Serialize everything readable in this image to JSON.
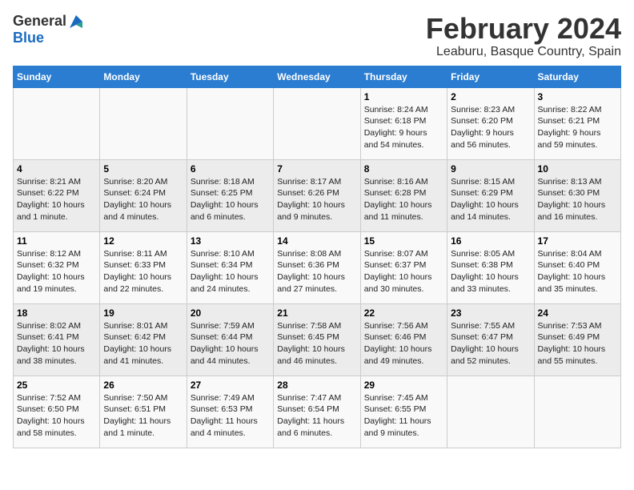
{
  "header": {
    "logo_general": "General",
    "logo_blue": "Blue",
    "month_title": "February 2024",
    "location": "Leaburu, Basque Country, Spain"
  },
  "weekdays": [
    "Sunday",
    "Monday",
    "Tuesday",
    "Wednesday",
    "Thursday",
    "Friday",
    "Saturday"
  ],
  "weeks": [
    [
      {
        "day": "",
        "info": ""
      },
      {
        "day": "",
        "info": ""
      },
      {
        "day": "",
        "info": ""
      },
      {
        "day": "",
        "info": ""
      },
      {
        "day": "1",
        "info": "Sunrise: 8:24 AM\nSunset: 6:18 PM\nDaylight: 9 hours\nand 54 minutes."
      },
      {
        "day": "2",
        "info": "Sunrise: 8:23 AM\nSunset: 6:20 PM\nDaylight: 9 hours\nand 56 minutes."
      },
      {
        "day": "3",
        "info": "Sunrise: 8:22 AM\nSunset: 6:21 PM\nDaylight: 9 hours\nand 59 minutes."
      }
    ],
    [
      {
        "day": "4",
        "info": "Sunrise: 8:21 AM\nSunset: 6:22 PM\nDaylight: 10 hours\nand 1 minute."
      },
      {
        "day": "5",
        "info": "Sunrise: 8:20 AM\nSunset: 6:24 PM\nDaylight: 10 hours\nand 4 minutes."
      },
      {
        "day": "6",
        "info": "Sunrise: 8:18 AM\nSunset: 6:25 PM\nDaylight: 10 hours\nand 6 minutes."
      },
      {
        "day": "7",
        "info": "Sunrise: 8:17 AM\nSunset: 6:26 PM\nDaylight: 10 hours\nand 9 minutes."
      },
      {
        "day": "8",
        "info": "Sunrise: 8:16 AM\nSunset: 6:28 PM\nDaylight: 10 hours\nand 11 minutes."
      },
      {
        "day": "9",
        "info": "Sunrise: 8:15 AM\nSunset: 6:29 PM\nDaylight: 10 hours\nand 14 minutes."
      },
      {
        "day": "10",
        "info": "Sunrise: 8:13 AM\nSunset: 6:30 PM\nDaylight: 10 hours\nand 16 minutes."
      }
    ],
    [
      {
        "day": "11",
        "info": "Sunrise: 8:12 AM\nSunset: 6:32 PM\nDaylight: 10 hours\nand 19 minutes."
      },
      {
        "day": "12",
        "info": "Sunrise: 8:11 AM\nSunset: 6:33 PM\nDaylight: 10 hours\nand 22 minutes."
      },
      {
        "day": "13",
        "info": "Sunrise: 8:10 AM\nSunset: 6:34 PM\nDaylight: 10 hours\nand 24 minutes."
      },
      {
        "day": "14",
        "info": "Sunrise: 8:08 AM\nSunset: 6:36 PM\nDaylight: 10 hours\nand 27 minutes."
      },
      {
        "day": "15",
        "info": "Sunrise: 8:07 AM\nSunset: 6:37 PM\nDaylight: 10 hours\nand 30 minutes."
      },
      {
        "day": "16",
        "info": "Sunrise: 8:05 AM\nSunset: 6:38 PM\nDaylight: 10 hours\nand 33 minutes."
      },
      {
        "day": "17",
        "info": "Sunrise: 8:04 AM\nSunset: 6:40 PM\nDaylight: 10 hours\nand 35 minutes."
      }
    ],
    [
      {
        "day": "18",
        "info": "Sunrise: 8:02 AM\nSunset: 6:41 PM\nDaylight: 10 hours\nand 38 minutes."
      },
      {
        "day": "19",
        "info": "Sunrise: 8:01 AM\nSunset: 6:42 PM\nDaylight: 10 hours\nand 41 minutes."
      },
      {
        "day": "20",
        "info": "Sunrise: 7:59 AM\nSunset: 6:44 PM\nDaylight: 10 hours\nand 44 minutes."
      },
      {
        "day": "21",
        "info": "Sunrise: 7:58 AM\nSunset: 6:45 PM\nDaylight: 10 hours\nand 46 minutes."
      },
      {
        "day": "22",
        "info": "Sunrise: 7:56 AM\nSunset: 6:46 PM\nDaylight: 10 hours\nand 49 minutes."
      },
      {
        "day": "23",
        "info": "Sunrise: 7:55 AM\nSunset: 6:47 PM\nDaylight: 10 hours\nand 52 minutes."
      },
      {
        "day": "24",
        "info": "Sunrise: 7:53 AM\nSunset: 6:49 PM\nDaylight: 10 hours\nand 55 minutes."
      }
    ],
    [
      {
        "day": "25",
        "info": "Sunrise: 7:52 AM\nSunset: 6:50 PM\nDaylight: 10 hours\nand 58 minutes."
      },
      {
        "day": "26",
        "info": "Sunrise: 7:50 AM\nSunset: 6:51 PM\nDaylight: 11 hours\nand 1 minute."
      },
      {
        "day": "27",
        "info": "Sunrise: 7:49 AM\nSunset: 6:53 PM\nDaylight: 11 hours\nand 4 minutes."
      },
      {
        "day": "28",
        "info": "Sunrise: 7:47 AM\nSunset: 6:54 PM\nDaylight: 11 hours\nand 6 minutes."
      },
      {
        "day": "29",
        "info": "Sunrise: 7:45 AM\nSunset: 6:55 PM\nDaylight: 11 hours\nand 9 minutes."
      },
      {
        "day": "",
        "info": ""
      },
      {
        "day": "",
        "info": ""
      }
    ]
  ]
}
